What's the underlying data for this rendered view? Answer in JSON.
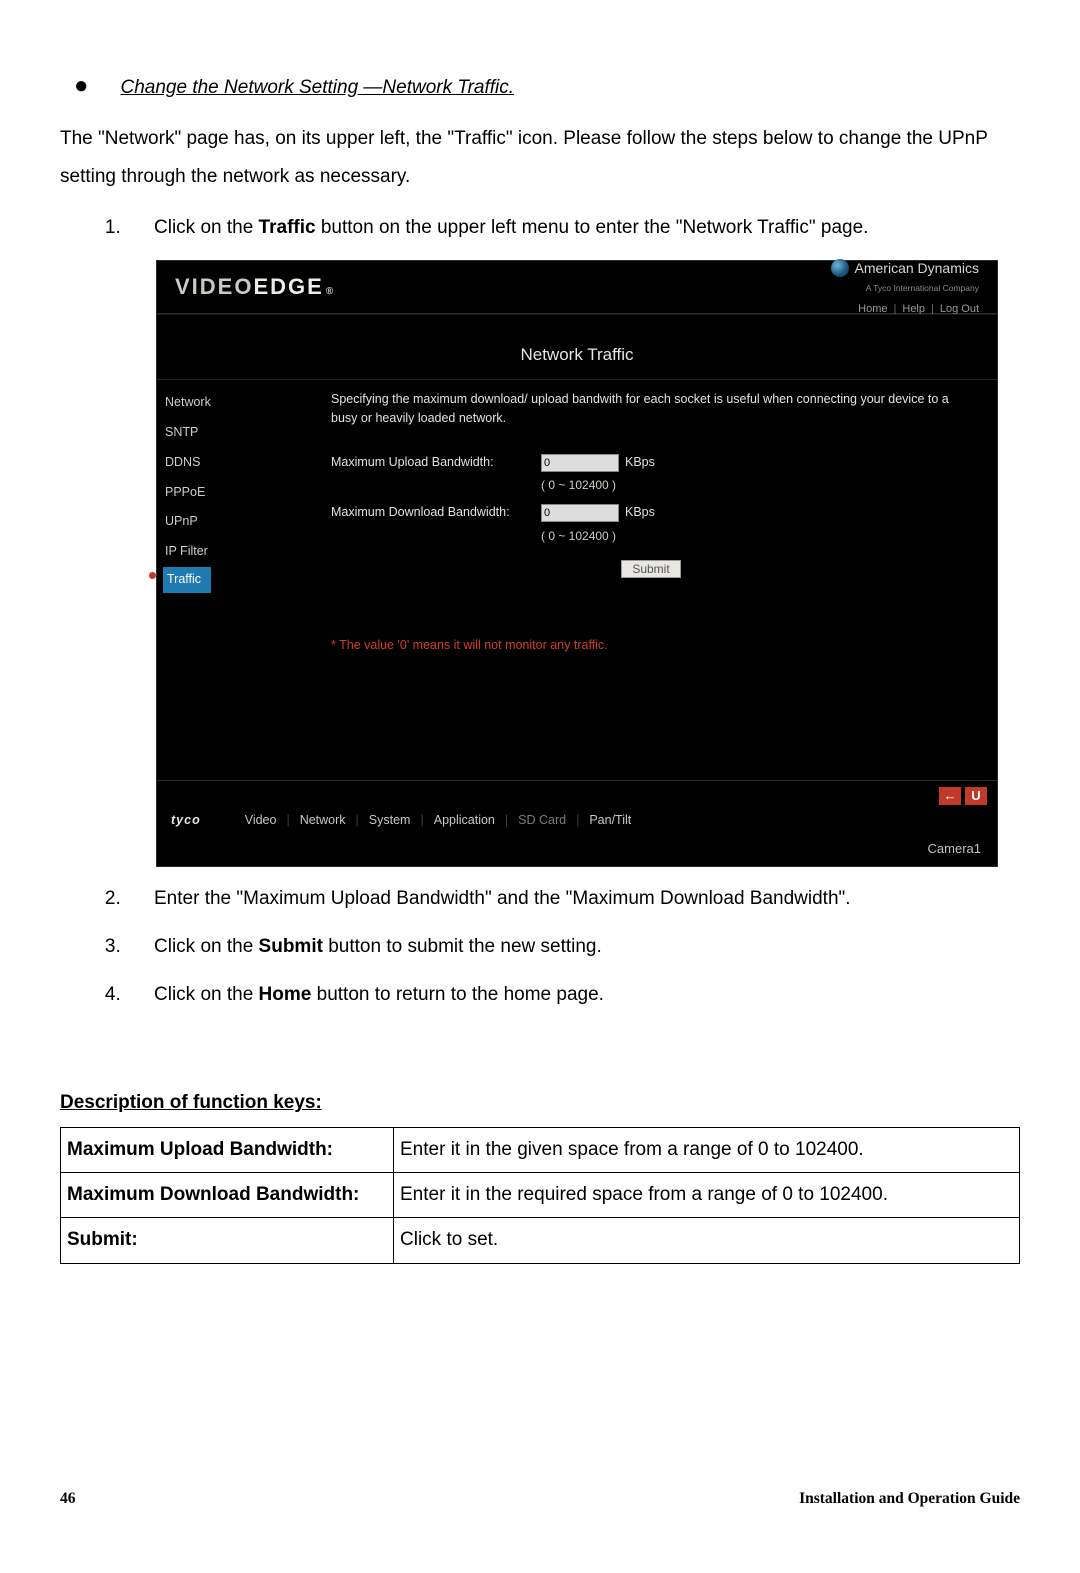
{
  "section": {
    "bullet_heading": "Change the Network Setting —Network Traffic.",
    "intro": "The \"Network\" page has, on its upper left, the \"Traffic\" icon. Please follow the steps below to change the UPnP setting through the network as necessary.",
    "steps": [
      {
        "pre": "Click on the ",
        "bold": "Traffic",
        "post": " button on the upper left menu to enter the \"Network Traffic\" page."
      },
      {
        "pre": "Enter the \"Maximum Upload Bandwidth\" and the \"Maximum Download Bandwidth\".",
        "bold": "",
        "post": ""
      },
      {
        "pre": "Click on the ",
        "bold": "Submit",
        "post": " button to submit the new setting."
      },
      {
        "pre": "Click on the ",
        "bold": "Home",
        "post": " button to return to the home page."
      }
    ]
  },
  "ui": {
    "brand_left_1": "VIDEO",
    "brand_left_2": "EDGE",
    "brand_sup": "®",
    "brand_right_name": "American Dynamics",
    "brand_right_sub": "A Tyco International Company",
    "top_links": [
      "Home",
      "Help",
      "Log Out"
    ],
    "page_title": "Network Traffic",
    "sidebar": [
      "Network",
      "SNTP",
      "DDNS",
      "PPPoE",
      "UPnP",
      "IP Filter",
      "Traffic"
    ],
    "sidebar_active_index": 6,
    "desc": "Specifying the maximum download/ upload bandwith for each socket is useful when connecting your device to a busy or heavily loaded network.",
    "fields": [
      {
        "label": "Maximum Upload Bandwidth:",
        "value": "0",
        "unit": "KBps",
        "range": "( 0 ~ 102400 )"
      },
      {
        "label": "Maximum Download Bandwidth:",
        "value": "0",
        "unit": "KBps",
        "range": "( 0 ~ 102400 )"
      }
    ],
    "submit_label": "Submit",
    "warn": "* The value '0' means it will not monitor any traffic.",
    "bottom_brand": "tyco",
    "bottom_tabs": [
      "Video",
      "Network",
      "System",
      "Application",
      "SD Card",
      "Pan/Tilt"
    ],
    "bottom_dim_index": 4,
    "camera_label": "Camera1",
    "back_icon": "←",
    "refresh_icon": "U"
  },
  "fk": {
    "heading": "Description of function keys:",
    "rows": [
      {
        "k": "Maximum Upload Bandwidth:",
        "v": "Enter it in the given space from a range of 0 to 102400."
      },
      {
        "k": "Maximum Download Bandwidth:",
        "v": "Enter it in the required space from a range of 0 to 102400."
      },
      {
        "k": "Submit:",
        "v": "Click to set."
      }
    ]
  },
  "footer": {
    "page_num": "46",
    "title": "Installation and Operation Guide"
  }
}
